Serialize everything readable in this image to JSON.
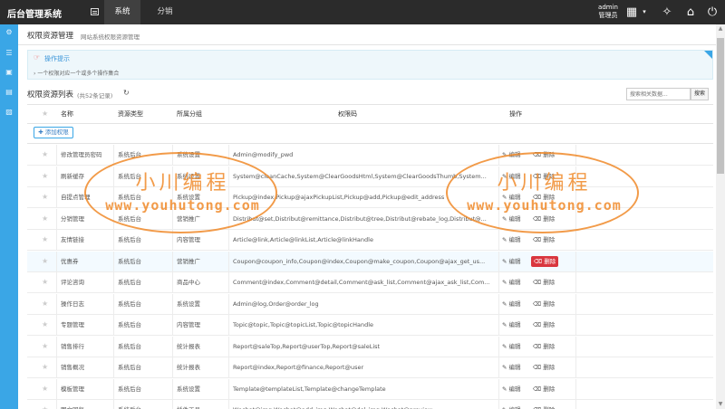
{
  "app": {
    "brand": "后台管理系统",
    "tabs": [
      {
        "label": "系统",
        "active": true
      },
      {
        "label": "分销",
        "active": false
      }
    ],
    "user": {
      "name": "admin",
      "role": "管理员"
    }
  },
  "page": {
    "title": "权限资源管理",
    "subtitle": "网站系统权限资源管理"
  },
  "tips": {
    "title": "操作提示",
    "text": "一个权限对应一个或多个操作集合"
  },
  "list": {
    "title": "权限资源列表",
    "count": "(共52条记录)",
    "search_placeholder": "搜索相关数据...",
    "search_button": "搜索",
    "add_button": "添加权限"
  },
  "table": {
    "headers": [
      "名称",
      "资源类型",
      "所属分组",
      "权限码",
      "操作"
    ],
    "actions": {
      "edit": "编辑",
      "delete": "删除"
    },
    "rows": [
      {
        "name": "修改管理员密码",
        "type": "系统后台",
        "group": "系统设置",
        "code": "Admin@modify_pwd",
        "highlight": false
      },
      {
        "name": "刷新缓存",
        "type": "系统后台",
        "group": "系统设置",
        "code": "System@cleanCache,System@ClearGoodsHtml,System@ClearGoodsThumb,System...",
        "highlight": false
      },
      {
        "name": "自提点管理",
        "type": "系统后台",
        "group": "系统设置",
        "code": "Pickup@index,Pickup@ajaxPickupList,Pickup@add,Pickup@edit_address",
        "highlight": false
      },
      {
        "name": "分销管理",
        "type": "系统后台",
        "group": "营销推广",
        "code": "Distribut@set,Distribut@remittance,Distribut@tree,Distribut@rebate_log,Distribut@...",
        "highlight": false
      },
      {
        "name": "友情链接",
        "type": "系统后台",
        "group": "内容管理",
        "code": "Article@link,Article@linkList,Article@linkHandle",
        "highlight": false
      },
      {
        "name": "优惠券",
        "type": "系统后台",
        "group": "营销推广",
        "code": "Coupon@coupon_info,Coupon@index,Coupon@make_coupon,Coupon@ajax_get_us...",
        "highlight": true
      },
      {
        "name": "评论咨询",
        "type": "系统后台",
        "group": "商品中心",
        "code": "Comment@index,Comment@detail,Comment@ask_list,Comment@ajax_ask_list,Com...",
        "highlight": false
      },
      {
        "name": "操作日志",
        "type": "系统后台",
        "group": "系统设置",
        "code": "Admin@log,Order@order_log",
        "highlight": false
      },
      {
        "name": "专题管理",
        "type": "系统后台",
        "group": "内容管理",
        "code": "Topic@topic,Topic@topicList,Topic@topicHandle",
        "highlight": false
      },
      {
        "name": "销售排行",
        "type": "系统后台",
        "group": "统计报表",
        "code": "Report@saleTop,Report@userTop,Report@saleList",
        "highlight": false
      },
      {
        "name": "销售概况",
        "type": "系统后台",
        "group": "统计报表",
        "code": "Report@index,Report@finance,Report@user",
        "highlight": false
      },
      {
        "name": "模板管理",
        "type": "系统后台",
        "group": "系统设置",
        "code": "Template@templateList,Template@changeTemplate",
        "highlight": false
      },
      {
        "name": "图文回复",
        "type": "系统后台",
        "group": "插件工具",
        "code": "Wechat@img,Wechat@add_img,Wechat@del_img,Wechat@preview",
        "highlight": false
      }
    ]
  },
  "watermark": {
    "title": "小川编程",
    "url": "www.youhutong.com",
    "color": "#f08a2a"
  },
  "colors": {
    "topbar": "#2b2b2b",
    "sidebar": "#3aa6e6",
    "accent": "#3aa6e6",
    "danger": "#d9363e"
  }
}
